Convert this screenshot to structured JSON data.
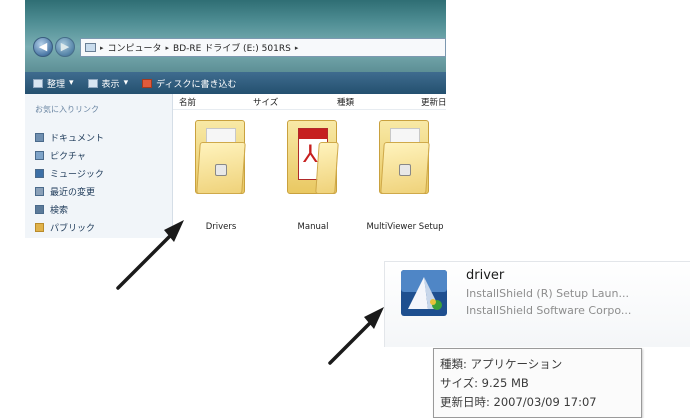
{
  "explorer": {
    "address": [
      "コンピュータ",
      "BD-RE ドライブ (E:) 501RS"
    ],
    "toolbar": {
      "organize": "整理",
      "views": "表示",
      "burn": "ディスクに書き込む"
    },
    "nav_pane": {
      "title": "お気に入りリンク",
      "items": [
        "ドキュメント",
        "ピクチャ",
        "ミュージック",
        "最近の変更",
        "検索",
        "パブリック"
      ]
    },
    "columns": [
      "名前",
      "サイズ",
      "種類",
      "更新日"
    ],
    "files": [
      {
        "name": "Drivers",
        "icon": "folder-icon"
      },
      {
        "name": "Manual",
        "icon": "pdf-folder-icon"
      },
      {
        "name": "MultiViewer Setup",
        "icon": "folder-icon"
      }
    ]
  },
  "tooltip_card": {
    "name": "driver",
    "description": "InstallShield (R) Setup Laun...",
    "company": "InstallShield Software Corpo...",
    "tooltip": {
      "type": "種類: アプリケーション",
      "size": "サイズ: 9.25 MB",
      "modified": "更新日時: 2007/03/09 17:07"
    }
  },
  "colors": {
    "titlebar": "#4e8d93",
    "toolbar": "#2f5b7c",
    "folder": "#efd27a",
    "arrow": "#1a1a1a"
  }
}
